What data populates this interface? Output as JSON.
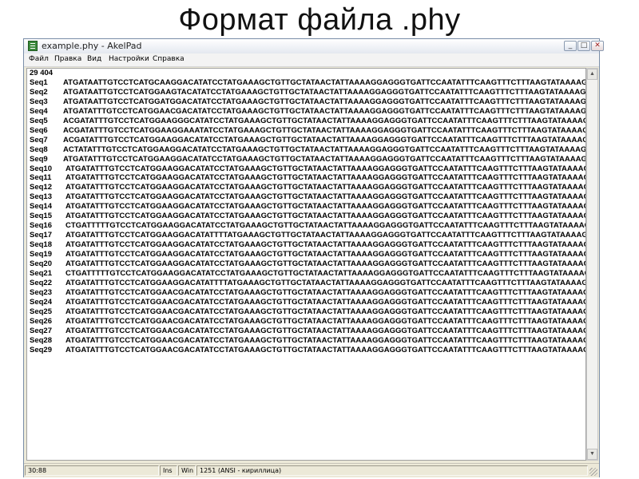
{
  "slide": {
    "title": "Формат файла .phy"
  },
  "window": {
    "title": "example.phy - AkelPad",
    "buttons": {
      "minimize": "_",
      "maximize": "□",
      "close": "✕"
    }
  },
  "menu": [
    "Файл",
    "Правка",
    "Вид",
    "Настройки",
    "Справка"
  ],
  "editor": {
    "header": "29 404",
    "rows": [
      {
        "name": "Seq1",
        "data": "ATGATAATTGTCCTCATGCAAGGACATATCCTATGAAAGCTGTTGCTATAACTATTAAAAGGAGGGTGATTCCAATATTTCAAGTTTCTTTAAGTATAAAAG"
      },
      {
        "name": "Seq2",
        "data": "ATGATAATTGTCCTCATGGAAGTACATATCCTATGAAAGCTGTTGCTATAACTATTAAAAGGAGGGTGATTCCAATATTTCAAGTTTCTTTAAGTATAAAAG"
      },
      {
        "name": "Seq3",
        "data": "ATGATAATTGTCCTCATGGATGGACATATCCTATGAAAGCTGTTGCTATAACTATTAAAAGGAGGGTGATTCCAATATTTCAAGTTTCTTTAAGTATAAAAG"
      },
      {
        "name": "Seq4",
        "data": "ATGATATTTGTCCTCATGGAACGACATATCCTATGAAAGCTGTTGCTATAACTATTAAAAGGAGGGTGATTCCAATATTTCAAGTTTCTTTAAGTATAAAAG"
      },
      {
        "name": "Seq5",
        "data": "ACGATATTTGTCCTCATGGAAGGGCATATCCTATGAAAGCTGTTGCTATAACTATTAAAAGGAGGGTGATTCCAATATTTCAAGTTTCTTTAAGTATAAAAG"
      },
      {
        "name": "Seq6",
        "data": "ACGATATTTGTCCTCATGGAAGGAAATATCCTATGAAAGCTGTTGCTATAACTATTAAAAGGAGGGTGATTCCAATATTTCAAGTTTCTTTAAGTATAAAAG"
      },
      {
        "name": "Seq7",
        "data": "ACGATATTTGTCCTCATGGAAGGACATATCCTATGAAAGCTGTTGCTATAACTATTAAAAGGAGGGTGATTCCAATATTTCAAGTTTCTTTAAGTATAAAAG"
      },
      {
        "name": "Seq8",
        "data": "ACTATATTTGTCCTCATGGAAGGACATATCCTATGAAAGCTGTTGCTATAACTATTAAAAGGAGGGTGATTCCAATATTTCAAGTTTCTTTAAGTATAAAAG"
      },
      {
        "name": "Seq9",
        "data": "ATGATATTTGTCCTCATGGAAGGACATATCCTATGAAAGCTGTTGCTATAACTATTAAAAGGAGGGTGATTCCAATATTTCAAGTTTCTTTAAGTATAAAAG"
      },
      {
        "name": "Seq10",
        "data": "ATGATATTTGTCCTCATGGAAGGACATATCCTATGAAAGCTGTTGCTATAACTATTAAAAGGAGGGTGATTCCAATATTTCAAGTTTCTTTAAGTATAAAAG"
      },
      {
        "name": "Seq11",
        "data": "ATGATATTTGTCCTCATGGAAGGACATATCCTATGAAAGCTGTTGCTATAACTATTAAAAGGAGGGTGATTCCAATATTTCAAGTTTCTTTAAGTATAAAAG"
      },
      {
        "name": "Seq12",
        "data": "ATGATATTTGTCCTCATGGAAGGACATATCCTATGAAAGCTGTTGCTATAACTATTAAAAGGAGGGTGATTCCAATATTTCAAGTTTCTTTAAGTATAAAAG"
      },
      {
        "name": "Seq13",
        "data": "ATGATATTTGTCCTCATGGAAGGACATATCCTATGAAAGCTGTTGCTATAACTATTAAAAGGAGGGTGATTCCAATATTTCAAGTTTCTTTAAGTATAAAAG"
      },
      {
        "name": "Seq14",
        "data": "ATGATATTTGTCCTCATGGAAGGACATATCCTATGAAAGCTGTTGCTATAACTATTAAAAGGAGGGTGATTCCAATATTTCAAGTTTCTTTAAGTATAAAAG"
      },
      {
        "name": "Seq15",
        "data": "ATGATATTTGTCCTCATGGAAGGACATATCCTATGAAAGCTGTTGCTATAACTATTAAAAGGAGGGTGATTCCAATATTTCAAGTTTCTTTAAGTATAAAAG"
      },
      {
        "name": "Seq16",
        "data": "CTGATTTTTGTCCTCATGGAAGGACATATCCTATGAAAGCTGTTGCTATAACTATTAAAAGGAGGGTGATTCCAATATTTCAAGTTTCTTTAAGTATAAAAG"
      },
      {
        "name": "Seq17",
        "data": "ATGATATTTGTCCTCATGGAAGGACATATTTTATGAAAGCTGTTGCTATAACTATTAAAAGGAGGGTGATTCCAATATTTCAAGTTTCTTTAAGTATAAAAG"
      },
      {
        "name": "Seq18",
        "data": "ATGATATTTGTCCTCATGGAAGGACATATCCTATGAAAGCTGTTGCTATAACTATTAAAAGGAGGGTGATTCCAATATTTCAAGTTTCTTTAAGTATAAAAG"
      },
      {
        "name": "Seq19",
        "data": "ATGATATTTGTCCTCATGGAAGGACATATCCTATGAAAGCTGTTGCTATAACTATTAAAAGGAGGGTGATTCCAATATTTCAAGTTTCTTTAAGTATAAAAG"
      },
      {
        "name": "Seq20",
        "data": "ATGATATTTGTCCTCATGGAAGGACATATCCTATGAAAGCTGTTGCTATAACTATTAAAAGGAGGGTGATTCCAATATTTCAAGTTTCTTTAAGTATAAAAG"
      },
      {
        "name": "Seq21",
        "data": "CTGATTTTTGTCCTCATGGAAGGACATATCCTATGAAAGCTGTTGCTATAACTATTAAAAGGAGGGTGATTCCAATATTTCAAGTTTCTTTAAGTATAAAAG"
      },
      {
        "name": "Seq22",
        "data": "ATGATATTTGTCCTCATGGAAGGACATATTTTATGAAAGCTGTTGCTATAACTATTAAAAGGAGGGTGATTCCAATATTTCAAGTTTCTTTAAGTATAAAAG"
      },
      {
        "name": "Seq23",
        "data": "ATGATATTTGTCCTCATGGAACGACATATCCTATGAAAGCTGTTGCTATAACTATTAAAAGGAGGGTGATTCCAATATTTCAAGTTTCTTTAAGTATAAAAG"
      },
      {
        "name": "Seq24",
        "data": "ATGATATTTGTCCTCATGGAACGACATATCCTATGAAAGCTGTTGCTATAACTATTAAAAGGAGGGTGATTCCAATATTTCAAGTTTCTTTAAGTATAAAAG"
      },
      {
        "name": "Seq25",
        "data": "ATGATATTTGTCCTCATGGAACGACATATCCTATGAAAGCTGTTGCTATAACTATTAAAAGGAGGGTGATTCCAATATTTCAAGTTTCTTTAAGTATAAAAG"
      },
      {
        "name": "Seq26",
        "data": "ATGATATTTGTCCTCATGGAACGACATATCCTATGAAAGCTGTTGCTATAACTATTAAAAGGAGGGTGATTCCAATATTTCAAGTTTCTTTAAGTATAAAAG"
      },
      {
        "name": "Seq27",
        "data": "ATGATATTTGTCCTCATGGAACGACATATCCTATGAAAGCTGTTGCTATAACTATTAAAAGGAGGGTGATTCCAATATTTCAAGTTTCTTTAAGTATAAAAG"
      },
      {
        "name": "Seq28",
        "data": "ATGATATTTGTCCTCATGGAACGACATATCCTATGAAAGCTGTTGCTATAACTATTAAAAGGAGGGTGATTCCAATATTTCAAGTTTCTTTAAGTATAAAAG"
      },
      {
        "name": "Seq29",
        "data": "ATGATATTTGTCCTCATGGAACGACATATCCTATGAAAGCTGTTGCTATAACTATTAAAAGGAGGGTGATTCCAATATTTCAAGTTTCTTTAAGTATAAAAG"
      }
    ]
  },
  "statusbar": {
    "position": "30:88",
    "insert_mode": "Ins",
    "newline": "Win",
    "encoding": "1251  (ANSI - кириллица)"
  }
}
